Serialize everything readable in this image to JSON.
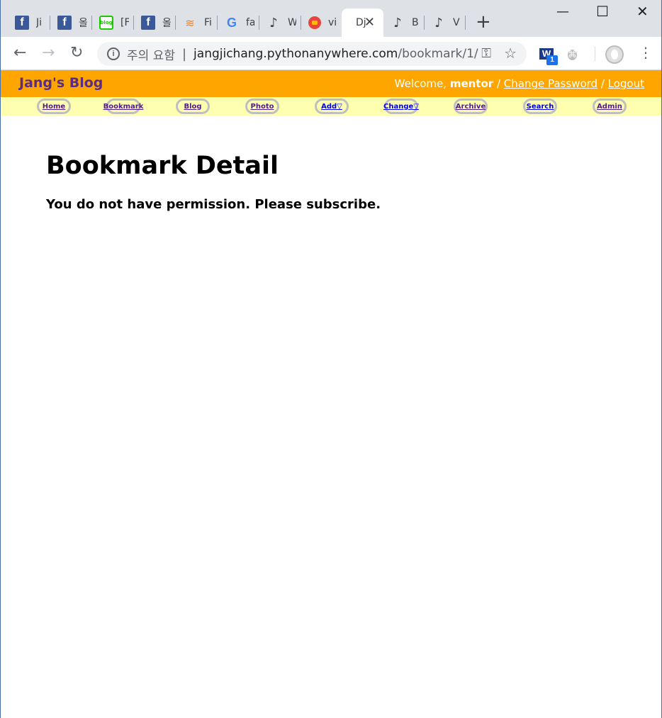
{
  "browser": {
    "tabs": [
      {
        "title": "Ji",
        "icon": "facebook-icon"
      },
      {
        "title": "올",
        "icon": "facebook-icon"
      },
      {
        "title": "[F",
        "icon": "naver-blog-icon"
      },
      {
        "title": "올",
        "icon": "facebook-icon"
      },
      {
        "title": "Fi",
        "icon": "stackoverflow-icon"
      },
      {
        "title": "fa",
        "icon": "google-icon"
      },
      {
        "title": "W",
        "icon": "pythonanywhere-icon"
      },
      {
        "title": "vi",
        "icon": "red-circle-icon"
      },
      {
        "title": "Dj",
        "icon": "",
        "active": true
      },
      {
        "title": "B",
        "icon": "pythonanywhere-icon"
      },
      {
        "title": "V",
        "icon": "pythonanywhere-icon"
      }
    ],
    "omnibox": {
      "security_label": "주의 요함",
      "url_host": "jangjichang.pythonanywhere.com",
      "url_path": "/bookmark/1/"
    },
    "extension_badge": "1"
  },
  "site": {
    "title": "Jang's Blog",
    "welcome": "Welcome,",
    "username": "mentor",
    "change_password": "Change Password",
    "logout": "Logout",
    "menu": [
      {
        "label": "Home"
      },
      {
        "label": "Bookmark"
      },
      {
        "label": "Blog"
      },
      {
        "label": "Photo"
      },
      {
        "label": "Add▽"
      },
      {
        "label": "Change▽"
      },
      {
        "label": "Archive"
      },
      {
        "label": "Search"
      },
      {
        "label": "Admin"
      }
    ]
  },
  "main": {
    "heading": "Bookmark Detail",
    "message": "You do not have permission. Please subscribe."
  }
}
